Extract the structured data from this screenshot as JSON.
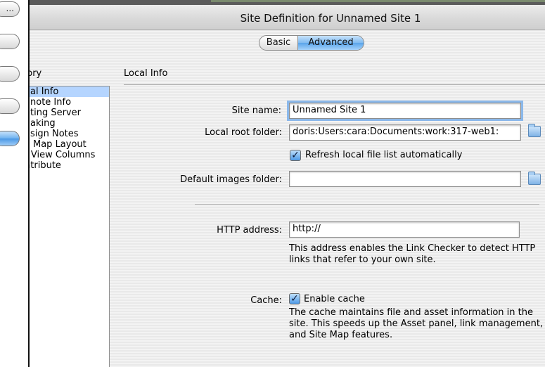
{
  "window": {
    "title": "Site Definition for Unnamed Site 1"
  },
  "tabs": {
    "basic": "Basic",
    "advanced": "Advanced"
  },
  "category": {
    "label": "gory",
    "items": [
      "al Info",
      "note Info",
      "ting Server",
      "aking",
      "sign Notes",
      "Map Layout",
      "File View Columns",
      "Contribute"
    ],
    "selected_index": 0
  },
  "sheet": {
    "buttons": [
      "...",
      "",
      "",
      "",
      ""
    ]
  },
  "section": {
    "title": "Local Info"
  },
  "form": {
    "site_name_label": "Site name:",
    "site_name_value": "Unnamed Site 1",
    "local_root_label": "Local root folder:",
    "local_root_value": "doris:Users:cara:Documents:work:317-web1:",
    "refresh_label": "Refresh local file list automatically",
    "refresh_checked": true,
    "default_images_label": "Default images folder:",
    "default_images_value": "",
    "http_label": "HTTP address:",
    "http_value": "http://",
    "http_help": "This address enables the Link Checker to detect HTTP links that refer to your own site.",
    "cache_label": "Cache:",
    "cache_checkbox_label": "Enable cache",
    "cache_checked": true,
    "cache_help": "The cache maintains file and asset information in the site.  This speeds up the Asset panel, link management, and Site Map features."
  }
}
